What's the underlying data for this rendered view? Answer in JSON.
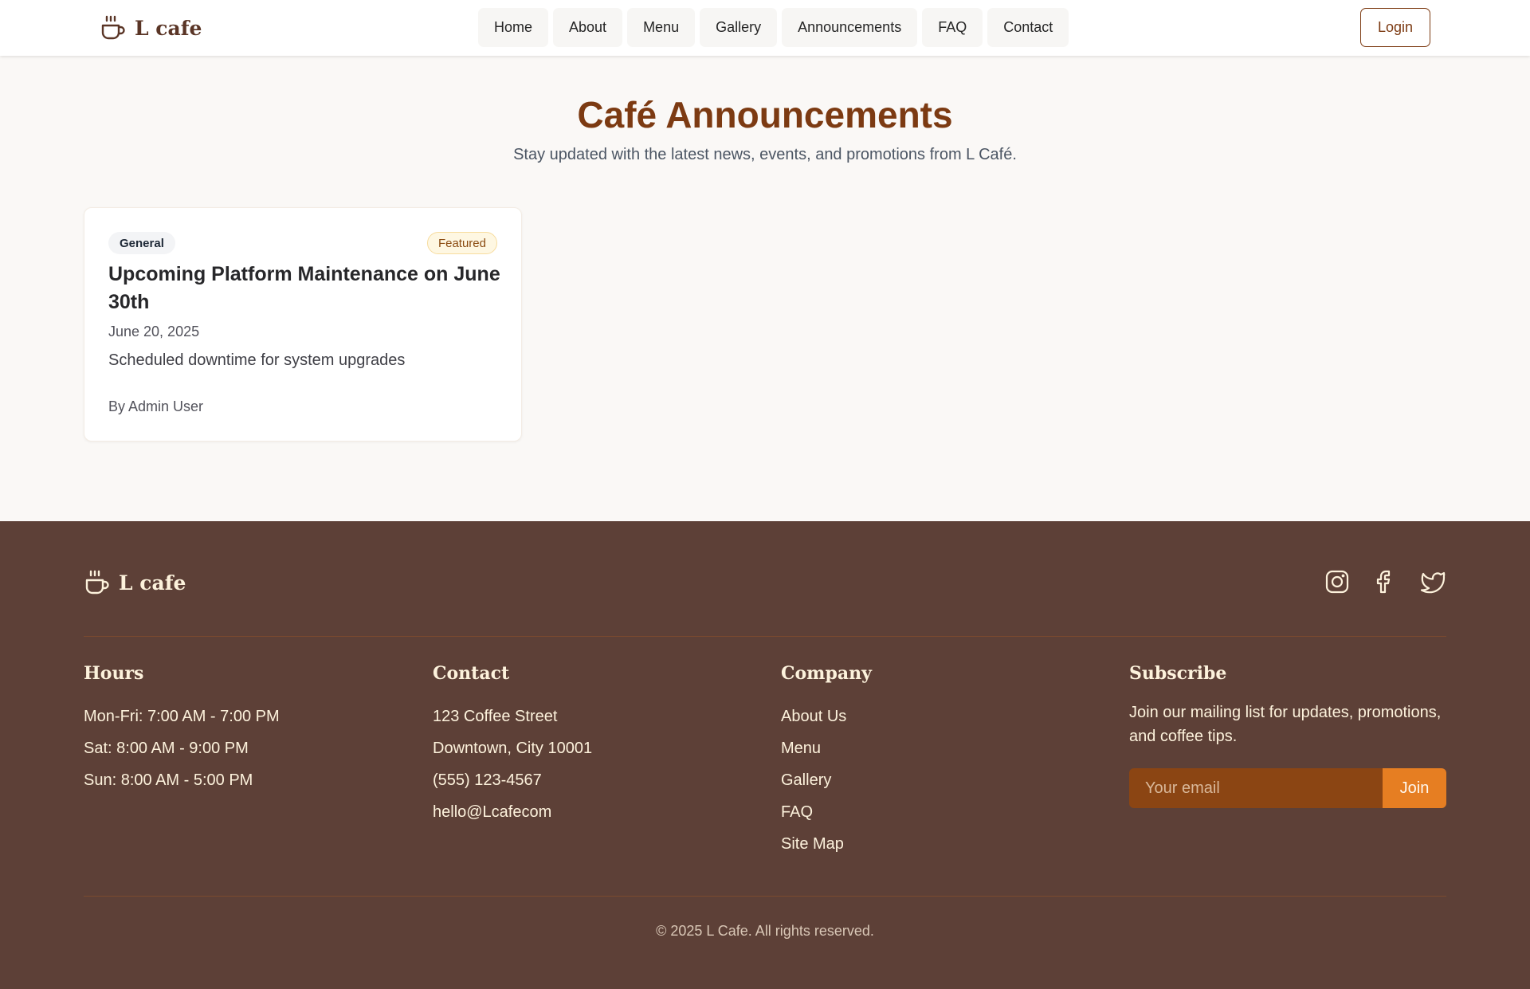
{
  "header": {
    "brand": "L cafe",
    "nav": [
      "Home",
      "About",
      "Menu",
      "Gallery",
      "Announcements",
      "FAQ",
      "Contact"
    ],
    "login": "Login"
  },
  "hero": {
    "title": "Café Announcements",
    "subtitle": "Stay updated with the latest news, events, and promotions from L Café."
  },
  "announcement": {
    "category": "General",
    "featured_badge": "Featured",
    "title": "Upcoming Platform Maintenance on June 30th",
    "date": "June 20, 2025",
    "excerpt": "Scheduled downtime for system upgrades",
    "author": "By Admin User"
  },
  "footer": {
    "brand": "L cafe",
    "social_icons": [
      "instagram-icon",
      "facebook-icon",
      "twitter-icon"
    ],
    "hours": {
      "title": "Hours",
      "lines": [
        "Mon-Fri: 7:00 AM - 7:00 PM",
        "Sat: 8:00 AM - 9:00 PM",
        "Sun: 8:00 AM - 5:00 PM"
      ]
    },
    "contact": {
      "title": "Contact",
      "lines": [
        "123 Coffee Street",
        "Downtown, City 10001",
        "(555) 123-4567",
        "hello@Lcafecom"
      ]
    },
    "company": {
      "title": "Company",
      "links": [
        "About Us",
        "Menu",
        "Gallery",
        "FAQ",
        "Site Map"
      ]
    },
    "subscribe": {
      "title": "Subscribe",
      "text": "Join our mailing list for updates, promotions, and coffee tips.",
      "placeholder": "Your email",
      "button": "Join"
    },
    "copyright": "© 2025 L Cafe. All rights reserved."
  },
  "colors": {
    "accent": "#7c3a12",
    "footer_bg": "#5d4037",
    "join_button": "#e67e22",
    "page_bg": "#faf8f6"
  }
}
